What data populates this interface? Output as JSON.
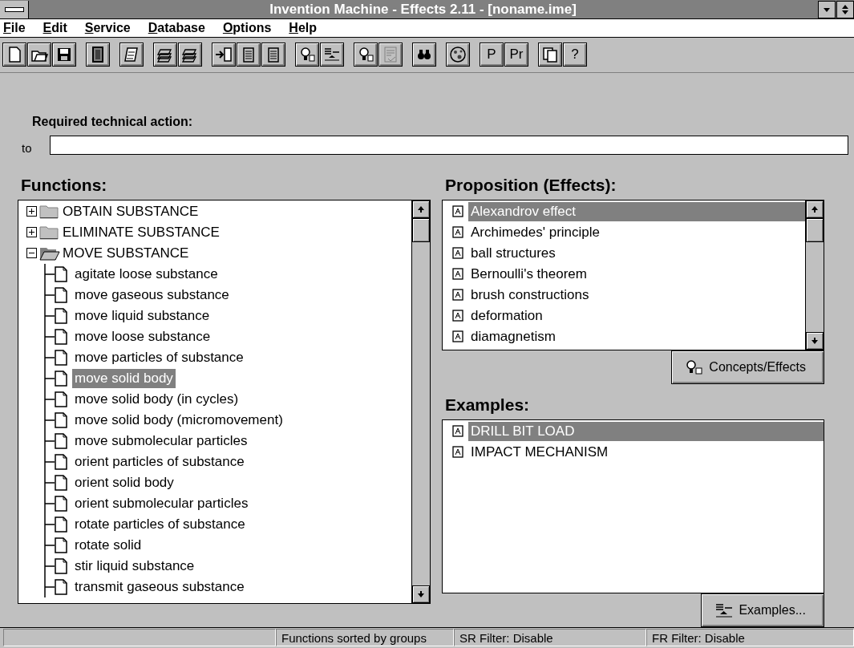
{
  "window": {
    "title": "Invention Machine - Effects 2.11 - [noname.ime]"
  },
  "menu": [
    "File",
    "Edit",
    "Service",
    "Database",
    "Options",
    "Help"
  ],
  "toolbar": [
    [
      {
        "kind": "new"
      },
      {
        "kind": "open"
      },
      {
        "kind": "save"
      }
    ],
    [
      {
        "kind": "book"
      }
    ],
    [
      {
        "kind": "note"
      }
    ],
    [
      {
        "kind": "stack"
      },
      {
        "kind": "stack"
      }
    ],
    [
      {
        "kind": "insert"
      },
      {
        "kind": "list"
      },
      {
        "kind": "list"
      }
    ],
    [
      {
        "kind": "bulb"
      },
      {
        "kind": "examples"
      }
    ],
    [
      {
        "kind": "bulb"
      },
      {
        "kind": "check"
      }
    ],
    [
      {
        "kind": "binoculars"
      }
    ],
    [
      {
        "kind": "globe"
      }
    ],
    [
      {
        "kind": "text",
        "label": "P"
      },
      {
        "kind": "text",
        "label": "Pr"
      }
    ],
    [
      {
        "kind": "copy"
      },
      {
        "kind": "text",
        "label": "?"
      }
    ]
  ],
  "action": {
    "label": "Required technical action:",
    "prefix": "to"
  },
  "functions": {
    "label": "Functions:",
    "tree": [
      {
        "label": "OBTAIN SUBSTANCE",
        "expanded": false,
        "selected": false
      },
      {
        "label": "ELIMINATE SUBSTANCE",
        "expanded": false,
        "selected": false
      },
      {
        "label": "MOVE SUBSTANCE",
        "expanded": true,
        "selected": false,
        "children": [
          {
            "label": "agitate loose substance",
            "selected": false
          },
          {
            "label": "move gaseous substance",
            "selected": false
          },
          {
            "label": "move liquid substance",
            "selected": false
          },
          {
            "label": "move loose substance",
            "selected": false
          },
          {
            "label": "move particles of substance",
            "selected": false
          },
          {
            "label": "move solid body",
            "selected": true
          },
          {
            "label": "move solid body (in cycles)",
            "selected": false
          },
          {
            "label": "move solid body (micromovement)",
            "selected": false
          },
          {
            "label": "move submolecular particles",
            "selected": false
          },
          {
            "label": "orient particles of substance",
            "selected": false
          },
          {
            "label": "orient solid body",
            "selected": false
          },
          {
            "label": "orient submolecular particles",
            "selected": false
          },
          {
            "label": "rotate particles of substance",
            "selected": false
          },
          {
            "label": "rotate solid",
            "selected": false
          },
          {
            "label": "stir liquid substance",
            "selected": false
          },
          {
            "label": "transmit gaseous substance",
            "selected": false
          }
        ]
      }
    ]
  },
  "propositions": {
    "label": "Proposition (Effects):",
    "items": [
      {
        "label": "Alexandrov effect",
        "selected": true
      },
      {
        "label": "Archimedes' principle",
        "selected": false
      },
      {
        "label": "ball structures",
        "selected": false
      },
      {
        "label": "Bernoulli's theorem",
        "selected": false
      },
      {
        "label": "brush constructions",
        "selected": false
      },
      {
        "label": "deformation",
        "selected": false
      },
      {
        "label": "diamagnetism",
        "selected": false
      }
    ],
    "button": "Concepts/Effects"
  },
  "examples": {
    "label": "Examples:",
    "items": [
      {
        "label": "DRILL BIT LOAD",
        "selected": true
      },
      {
        "label": "IMPACT MECHANISM",
        "selected": false
      }
    ],
    "button": "Examples..."
  },
  "status_bar": [
    "Functions sorted by groups",
    "SR Filter: Disable",
    "FR Filter: Disable"
  ]
}
